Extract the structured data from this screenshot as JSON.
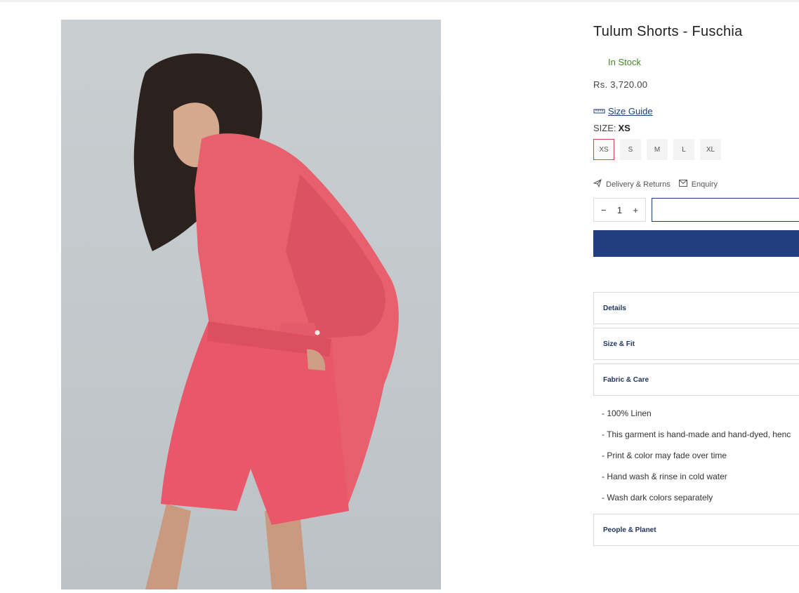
{
  "product": {
    "title": "Tulum Shorts - Fuschia",
    "stock_status": "In Stock",
    "price": "Rs. 3,720.00"
  },
  "size_guide": {
    "label": "Size Guide",
    "icon": "ruler-icon"
  },
  "size_selector": {
    "label": "SIZE:",
    "selected": "XS",
    "options": [
      "XS",
      "S",
      "M",
      "L",
      "XL"
    ]
  },
  "links": {
    "delivery": "Delivery & Returns",
    "delivery_icon": "paper-plane-icon",
    "enquiry": "Enquiry",
    "enquiry_icon": "envelope-icon"
  },
  "quantity": {
    "minus": "−",
    "value": "1",
    "plus": "+"
  },
  "accordion": {
    "details": "Details",
    "size_fit": "Size & Fit",
    "fabric_care": "Fabric & Care",
    "people_planet": "People & Planet"
  },
  "fabric_care_items": [
    "- 100% Linen",
    "- This garment is hand-made and hand-dyed, henc",
    "- Print & color may fade over time",
    "- Hand wash & rinse in cold water",
    "- Wash dark colors separately"
  ],
  "colors": {
    "accent": "#213f7f",
    "stock_green": "#3f8a1e",
    "selected_border": "#d94545",
    "garment": "#e85a6a"
  }
}
